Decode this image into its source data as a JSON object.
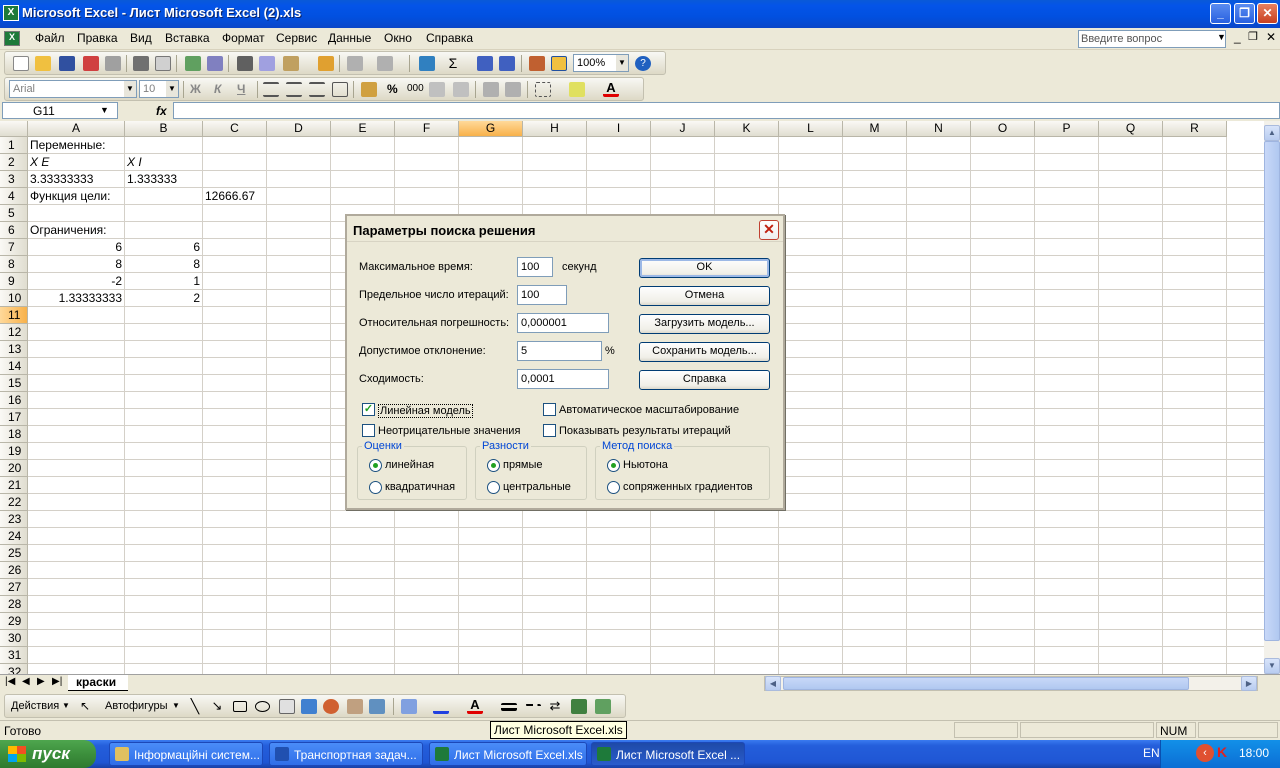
{
  "window": {
    "title": "Microsoft Excel - Лист Microsoft Excel (2).xls",
    "icon": "excel-icon"
  },
  "menu": {
    "items": [
      "Файл",
      "Правка",
      "Вид",
      "Вставка",
      "Формат",
      "Сервис",
      "Данные",
      "Окно",
      "Справка"
    ],
    "ask_placeholder": "Введите вопрос"
  },
  "toolbar": {
    "zoom": "100%",
    "font": "Arial",
    "font_size": "10",
    "bold": "Ж",
    "italic": "К",
    "underline": "Ч",
    "percent": "%",
    "thousands": "000"
  },
  "formula_bar": {
    "name_box": "G11",
    "fx": "fx",
    "content": ""
  },
  "grid": {
    "columns": [
      "A",
      "B",
      "C",
      "D",
      "E",
      "F",
      "G",
      "H",
      "I",
      "J",
      "K",
      "L",
      "M",
      "N",
      "O",
      "P",
      "Q",
      "R"
    ],
    "selected_column": "G",
    "selected_row": "11",
    "rows": [
      "1",
      "2",
      "3",
      "4",
      "5",
      "6",
      "7",
      "8",
      "9",
      "10",
      "11",
      "12",
      "13",
      "14",
      "15",
      "16",
      "17",
      "18",
      "19",
      "20",
      "21",
      "22",
      "23",
      "24",
      "25",
      "26",
      "27",
      "28",
      "29",
      "30",
      "31",
      "32"
    ],
    "cells": [
      {
        "ref": "A1",
        "value": "Переменные:"
      },
      {
        "ref": "A2",
        "value": "X E"
      },
      {
        "ref": "B2",
        "value": "X I"
      },
      {
        "ref": "A3",
        "value": "3.33333333"
      },
      {
        "ref": "B3",
        "value": "1.333333"
      },
      {
        "ref": "A4",
        "value": "Функция цели:"
      },
      {
        "ref": "C4",
        "value": "12666.67"
      },
      {
        "ref": "A6",
        "value": "Ограничения:"
      },
      {
        "ref": "A7",
        "value": "6"
      },
      {
        "ref": "B7",
        "value": "6"
      },
      {
        "ref": "A8",
        "value": "8"
      },
      {
        "ref": "B8",
        "value": "8"
      },
      {
        "ref": "A9",
        "value": "-2"
      },
      {
        "ref": "B9",
        "value": "1"
      },
      {
        "ref": "A10",
        "value": "1.33333333"
      },
      {
        "ref": "B10",
        "value": "2"
      }
    ]
  },
  "sheet_tab": "краски",
  "drawing_toolbar": {
    "actions": "Действия",
    "autoshapes": "Автофигуры"
  },
  "status": {
    "ready": "Готово",
    "num": "NUM"
  },
  "tooltip": "Лист Microsoft Excel.xls",
  "dialog": {
    "title": "Параметры поиска решения",
    "max_time_label": "Максимальное время:",
    "max_time_value": "100",
    "max_time_unit": "секунд",
    "iter_label": "Предельное число итераций:",
    "iter_value": "100",
    "precision_label": "Относительная погрешность:",
    "precision_value": "0,000001",
    "tolerance_label": "Допустимое отклонение:",
    "tolerance_value": "5",
    "tolerance_unit": "%",
    "convergence_label": "Сходимость:",
    "convergence_value": "0,0001",
    "buttons": {
      "ok": "OK",
      "cancel": "Отмена",
      "load": "Загрузить модель...",
      "save": "Сохранить модель...",
      "help": "Справка"
    },
    "checkboxes": {
      "linear": {
        "label": "Линейная модель",
        "checked": true
      },
      "auto_scale": {
        "label": "Автоматическое масштабирование",
        "checked": false
      },
      "nonneg": {
        "label": "Неотрицательные значения",
        "checked": false
      },
      "show_iter": {
        "label": "Показывать результаты итераций",
        "checked": false
      }
    },
    "estimates": {
      "title": "Оценки",
      "opt1": "линейная",
      "opt2": "квадратичная",
      "selected": 1
    },
    "derivatives": {
      "title": "Разности",
      "opt1": "прямые",
      "opt2": "центральные",
      "selected": 1
    },
    "search": {
      "title": "Метод поиска",
      "opt1": "Ньютона",
      "opt2": "сопряженных градиентов",
      "selected": 1
    }
  },
  "taskbar": {
    "start": "пуск",
    "tasks": [
      "Інформаційні систем...",
      "Транспортная задач...",
      "Лист Microsoft Excel.xls",
      "Лист Microsoft Excel ..."
    ],
    "lang": "EN",
    "time": "18:00"
  }
}
